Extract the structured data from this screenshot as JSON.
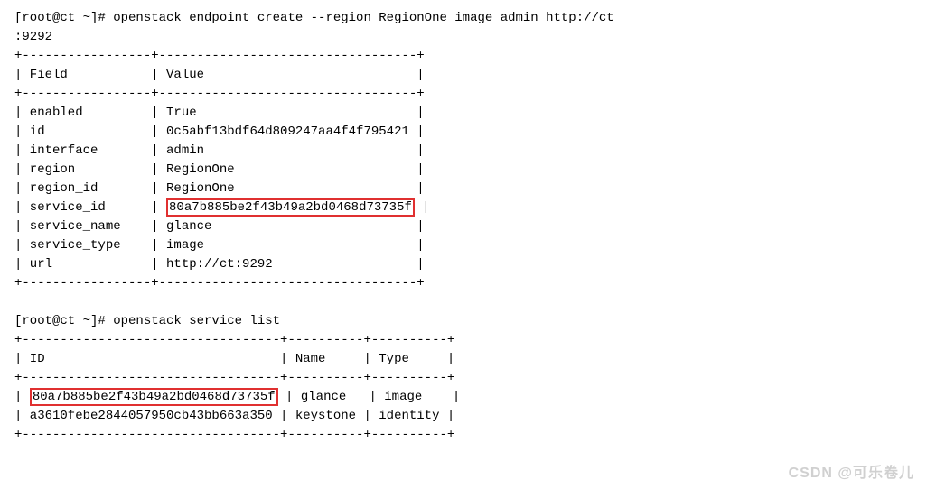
{
  "terminal": {
    "lines": [
      {
        "id": "cmd1",
        "text": "[root@ct ~]# openstack endpoint create --region RegionOne image admin http://ct",
        "type": "command"
      },
      {
        "id": "cmd1b",
        "text": ":9292",
        "type": "command"
      },
      {
        "id": "sep1",
        "text": "+-----------------+----------------------------------+",
        "type": "separator"
      },
      {
        "id": "header",
        "text": "| Field           | Value                            |",
        "type": "normal"
      },
      {
        "id": "sep2",
        "text": "+-----------------+----------------------------------+",
        "type": "separator"
      },
      {
        "id": "r1",
        "text": "| enabled         | True                             |",
        "type": "normal"
      },
      {
        "id": "r2",
        "text": "| id              | 0c5abf13bdf64d809247aa4f4f795421 |",
        "type": "normal"
      },
      {
        "id": "r3",
        "text": "| interface       | admin                            |",
        "type": "normal"
      },
      {
        "id": "r4",
        "text": "| region          | RegionOne                        |",
        "type": "normal"
      },
      {
        "id": "r5",
        "text": "| region_id       | RegionOne                        |",
        "type": "normal"
      },
      {
        "id": "r6_pre",
        "text": "| service_id      | ",
        "type": "normal",
        "highlight": "80a7b885be2f43b49a2bd0468d73735f",
        "post": " |"
      },
      {
        "id": "r7",
        "text": "| service_name    | glance                           |",
        "type": "normal"
      },
      {
        "id": "r8",
        "text": "| service_type    | image                            |",
        "type": "normal"
      },
      {
        "id": "r9",
        "text": "| url             | http://ct:9292                   |",
        "type": "normal"
      },
      {
        "id": "sep3",
        "text": "+-----------------+----------------------------------+",
        "type": "separator"
      },
      {
        "id": "blank",
        "text": "",
        "type": "normal"
      },
      {
        "id": "cmd2",
        "text": "[root@ct ~]# openstack service list",
        "type": "command"
      },
      {
        "id": "sep4",
        "text": "+----------------------------------+----------+----------+",
        "type": "separator"
      },
      {
        "id": "header2",
        "text": "| ID                               | Name     | Type     |",
        "type": "normal"
      },
      {
        "id": "sep5",
        "text": "+----------------------------------+----------+----------+",
        "type": "separator"
      },
      {
        "id": "sr1_pre",
        "text": "| ",
        "type": "normal",
        "highlight": "80a7b885be2f43b49a2bd0468d73735f",
        "post": " | glance   | image    |"
      },
      {
        "id": "sr2",
        "text": "| a3610febe2844057950cb43bb663a350 | keystone | identity |",
        "type": "normal"
      },
      {
        "id": "sep6",
        "text": "+----------------------------------+----------+----------+",
        "type": "separator"
      }
    ],
    "watermark": "CSDN @可乐卷儿"
  }
}
